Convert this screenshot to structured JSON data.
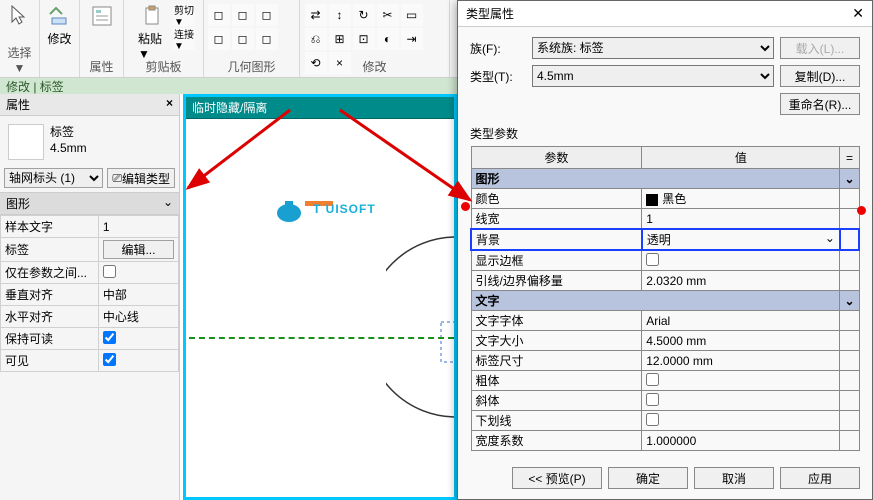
{
  "ribbon": {
    "groups": {
      "select": "选择 ▼",
      "modify": "修改",
      "properties": "属性",
      "clipboard": "剪贴板",
      "geometry": "几何图形",
      "modify_grp": "修改",
      "paste": "粘贴 ▼",
      "cut": "剪切 ▼",
      "join": "连接 ▼"
    }
  },
  "context_tab": "修改 | 标签",
  "prop_panel": {
    "title": "属性",
    "type_line1": "标签",
    "type_line2": "4.5mm",
    "inst_select": "轴网标头 (1)",
    "edit_type_btn": "编辑类型",
    "section": "图形",
    "rows": {
      "sample": {
        "k": "样本文字",
        "v": "1"
      },
      "label": {
        "k": "标签",
        "btn": "编辑..."
      },
      "param_only": {
        "k": "仅在参数之间...",
        "v": false
      },
      "valign": {
        "k": "垂直对齐",
        "v": "中部"
      },
      "halign": {
        "k": "水平对齐",
        "v": "中心线"
      },
      "keep": {
        "k": "保持可读",
        "v": true
      },
      "visible": {
        "k": "可见",
        "v": true
      }
    }
  },
  "canvas": {
    "header": "临时隐藏/隔离"
  },
  "watermark": "T   UISOFT",
  "dialog": {
    "title": "类型属性",
    "family_label": "族(F):",
    "family_value": "系统族: 标签",
    "type_label": "类型(T):",
    "type_value": "4.5mm",
    "btn_load": "载入(L)...",
    "btn_copy": "复制(D)...",
    "btn_rename": "重命名(R)...",
    "param_header": "类型参数",
    "col_param": "参数",
    "col_value": "值",
    "groups": {
      "graphics": "图形",
      "text": "文字"
    },
    "rows": {
      "color": {
        "k": "颜色",
        "v": "黑色"
      },
      "lw": {
        "k": "线宽",
        "v": "1"
      },
      "bg": {
        "k": "背景",
        "v": "透明"
      },
      "border": {
        "k": "显示边框",
        "v": false
      },
      "offset": {
        "k": "引线/边界偏移量",
        "v": "2.0320 mm"
      },
      "font": {
        "k": "文字字体",
        "v": "Arial"
      },
      "size": {
        "k": "文字大小",
        "v": "4.5000 mm"
      },
      "tab": {
        "k": "标签尺寸",
        "v": "12.0000 mm"
      },
      "bold": {
        "k": "粗体",
        "v": false
      },
      "italic": {
        "k": "斜体",
        "v": false
      },
      "ul": {
        "k": "下划线",
        "v": false
      },
      "wfac": {
        "k": "宽度系数",
        "v": "1.000000"
      }
    },
    "preview": "<< 预览(P)",
    "ok": "确定",
    "cancel": "取消",
    "apply": "应用"
  }
}
